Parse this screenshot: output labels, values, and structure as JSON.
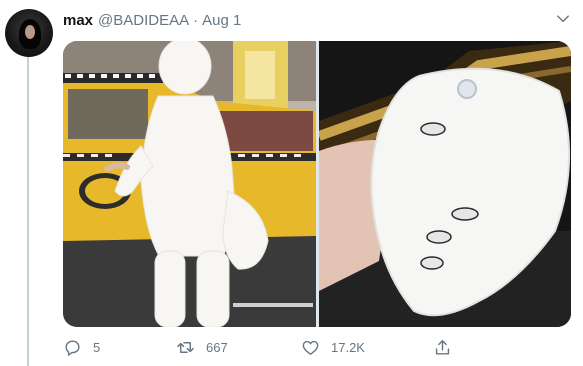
{
  "tweet": {
    "display_name": "max",
    "handle": "@BADIDEAA",
    "separator": "·",
    "date": "Aug 1"
  },
  "icons": {
    "menu": "chevron-down-icon",
    "reply": "reply-icon",
    "retweet": "retweet-icon",
    "like": "heart-icon",
    "share": "share-icon"
  },
  "stats": {
    "replies": "5",
    "retweets": "667",
    "likes": "17.2K"
  },
  "colors": {
    "secondary_text": "#657786",
    "thread_line": "#c4cfd6"
  }
}
